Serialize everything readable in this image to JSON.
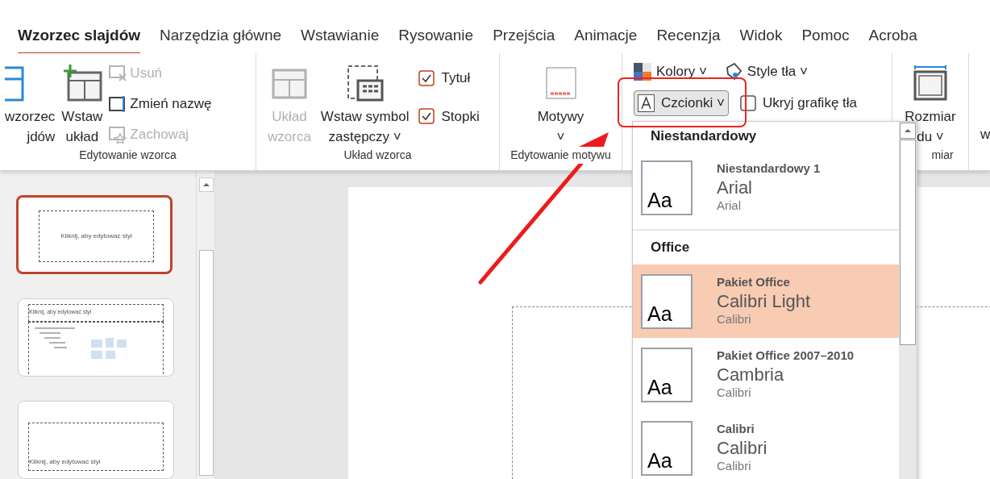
{
  "tabs": [
    {
      "label": "Wzorzec slajdów",
      "selected": true
    },
    {
      "label": "Narzędzia główne",
      "selected": false
    },
    {
      "label": "Wstawianie",
      "selected": false
    },
    {
      "label": "Rysowanie",
      "selected": false
    },
    {
      "label": "Przejścia",
      "selected": false
    },
    {
      "label": "Animacje",
      "selected": false
    },
    {
      "label": "Recenzja",
      "selected": false
    },
    {
      "label": "Widok",
      "selected": false
    },
    {
      "label": "Pomoc",
      "selected": false
    },
    {
      "label": "Acroba",
      "selected": false
    }
  ],
  "ribbon": {
    "edit_master": {
      "label": "Edytowanie wzorca",
      "insert_master": [
        "wzorzec",
        "jdów"
      ],
      "insert_layout": [
        "Wstaw",
        "układ"
      ],
      "small": [
        {
          "kind": "delete",
          "label": "Usuń",
          "disabled": true
        },
        {
          "kind": "rename",
          "label": "Zmień nazwę",
          "disabled": false
        },
        {
          "kind": "preserve",
          "label": "Zachowaj",
          "disabled": true
        }
      ]
    },
    "master_layout": {
      "label": "Układ wzorca",
      "layout": {
        "lines": [
          "Układ",
          "wzorca"
        ],
        "disabled": true
      },
      "placeholder": {
        "lines": [
          "Wstaw symbol",
          "zastępczy"
        ],
        "caret": "˅"
      },
      "checks": [
        {
          "label": "Tytuł",
          "checked": true
        },
        {
          "label": "Stopki",
          "checked": true
        }
      ]
    },
    "edit_theme": {
      "label": "Edytowanie motywu",
      "themes": "Motywy",
      "caret": "˅"
    },
    "background": {
      "colors": "Kolory",
      "colors_caret": "˅",
      "styles": "Style tła",
      "styles_caret": "˅",
      "fonts": "Czcionki",
      "fonts_caret": "˅",
      "hide": {
        "label": "Ukryj grafikę tła",
        "checked": false
      }
    },
    "size": {
      "label": "miar",
      "button": "Rozmiar",
      "button_line2": "du",
      "caret": "˅",
      "next": "w"
    }
  },
  "slides": [
    {
      "title": "Kliknij, aby edytować styl",
      "kind": "title",
      "selected": true
    },
    {
      "title": "Kliknij, aby edytować styl",
      "kind": "content",
      "selected": false
    },
    {
      "title": "Kliknij, aby edytować styl",
      "kind": "section",
      "selected": false
    }
  ],
  "fonts_menu": {
    "sections": [
      {
        "heading": "Niestandardowy",
        "items": [
          {
            "name": "Niestandardowy 1",
            "heading_font": "Arial",
            "body_font": "Arial",
            "sample": "Aa",
            "selected": false
          }
        ]
      },
      {
        "heading": "Office",
        "items": [
          {
            "name": "Pakiet Office",
            "heading_font": "Calibri Light",
            "body_font": "Calibri",
            "sample": "Aa",
            "selected": true
          },
          {
            "name": "Pakiet Office 2007–2010",
            "heading_font": "Cambria",
            "body_font": "Calibri",
            "sample": "Aa",
            "selected": false
          },
          {
            "name": "Calibri",
            "heading_font": "Calibri",
            "body_font": "Calibri",
            "sample": "Aa",
            "selected": false
          }
        ]
      }
    ]
  }
}
